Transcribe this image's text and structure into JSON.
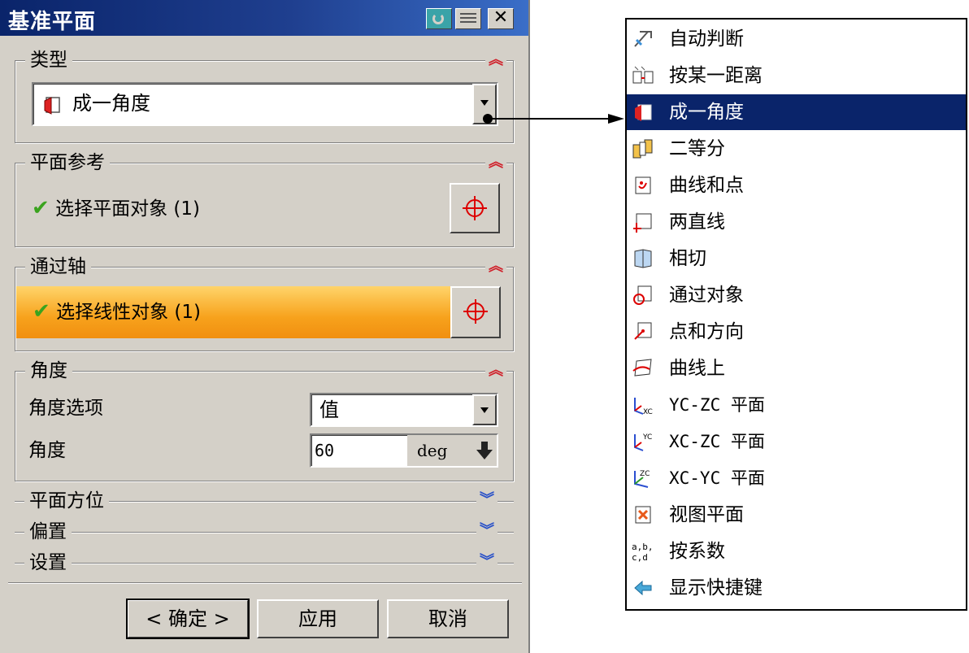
{
  "dialog": {
    "title": "基准平面",
    "type_group": {
      "label": "类型",
      "selected": "成一角度"
    },
    "plane_ref_group": {
      "label": "平面参考",
      "status": "选择平面对象 (1)"
    },
    "axis_group": {
      "label": "通过轴",
      "status": "选择线性对象 (1)"
    },
    "angle_group": {
      "label": "角度",
      "option_label": "角度选项",
      "option_value": "值",
      "angle_label": "角度",
      "angle_value": "60",
      "unit": "deg"
    },
    "collapsed_groups": [
      "平面方位",
      "偏置",
      "设置"
    ],
    "buttons": {
      "ok": "< 确定 >",
      "apply": "应用",
      "cancel": "取消"
    }
  },
  "dropdown": {
    "selected_index": 2,
    "items": [
      {
        "label": "自动判断",
        "icon": "auto-infer-icon"
      },
      {
        "label": "按某一距离",
        "icon": "at-distance-icon"
      },
      {
        "label": "成一角度",
        "icon": "at-angle-icon"
      },
      {
        "label": "二等分",
        "icon": "bisector-icon"
      },
      {
        "label": "曲线和点",
        "icon": "curves-and-points-icon"
      },
      {
        "label": "两直线",
        "icon": "two-lines-icon"
      },
      {
        "label": "相切",
        "icon": "tangent-icon"
      },
      {
        "label": "通过对象",
        "icon": "through-object-icon"
      },
      {
        "label": "点和方向",
        "icon": "point-and-direction-icon"
      },
      {
        "label": "曲线上",
        "icon": "on-curve-icon"
      },
      {
        "label": "YC-ZC 平面",
        "icon": "yc-zc-plane-icon"
      },
      {
        "label": "XC-ZC 平面",
        "icon": "xc-zc-plane-icon"
      },
      {
        "label": "XC-YC 平面",
        "icon": "xc-yc-plane-icon"
      },
      {
        "label": "视图平面",
        "icon": "view-plane-icon"
      },
      {
        "label": "按系数",
        "icon": "coefficients-icon"
      },
      {
        "label": "显示快捷键",
        "icon": "show-shortcuts-icon"
      }
    ]
  },
  "colors": {
    "title_bar": "#0a246a",
    "selected_row": "#0a246a",
    "active_highlight": "#f7a21c",
    "check": "#3aa31e"
  }
}
